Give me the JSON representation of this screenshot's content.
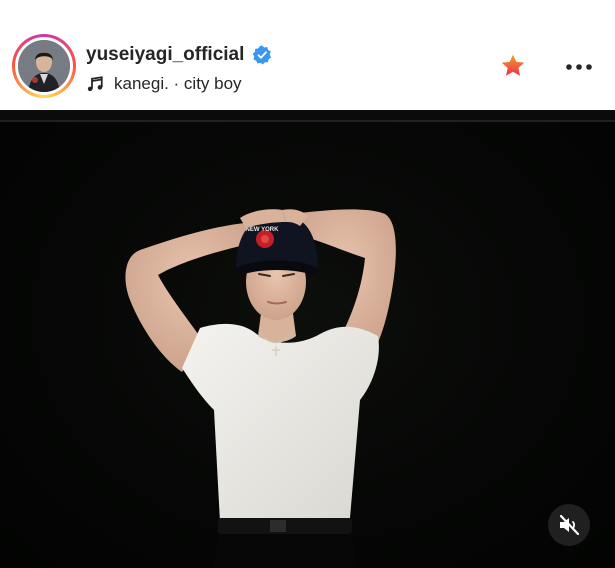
{
  "post_header": {
    "username": "yuseiyagi_official",
    "audio": "kanegi. · city boy",
    "verified": true
  },
  "icons": {
    "verified": "verified-badge-icon",
    "audio": "music-note-icon",
    "favorite": "star-icon",
    "more": "more-options-icon",
    "mute": "speaker-muted-icon"
  },
  "colors": {
    "verified_blue": "#3897f0",
    "favorite_star": "#f0543a",
    "text": "#262626"
  },
  "photo": {
    "cap_text": "NEW YORK"
  }
}
